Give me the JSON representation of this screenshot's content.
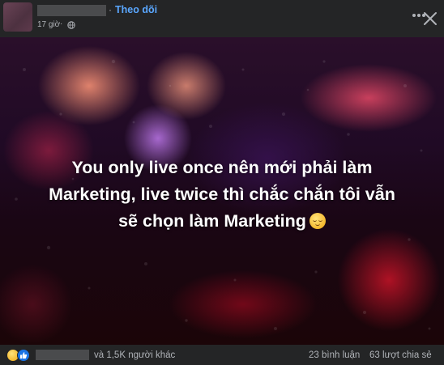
{
  "header": {
    "separator": "·",
    "follow_label": "Theo dõi",
    "time": "17 giờ",
    "time_separator": "·",
    "privacy_icon": "globe-icon",
    "more_icon": "more-options-icon",
    "close_icon": "close-icon"
  },
  "post": {
    "text_line1": "You only live once nên mới phải làm",
    "text_line2": "Marketing, live twice thì chắc chắn tôi vẫn",
    "text_line3": "sẽ chọn làm Marketing",
    "emoji": "relieved-face-emoji"
  },
  "footer": {
    "reaction_icons": [
      "haha-icon",
      "like-icon"
    ],
    "others_text": "và 1,5K người khác",
    "comments_text": "23 bình luận",
    "shares_text": "63 lượt chia sẻ"
  },
  "colors": {
    "background": "#242526",
    "link": "#5aa7ff",
    "secondary_text": "#b0b3b8",
    "like_blue": "#1b74e4"
  }
}
